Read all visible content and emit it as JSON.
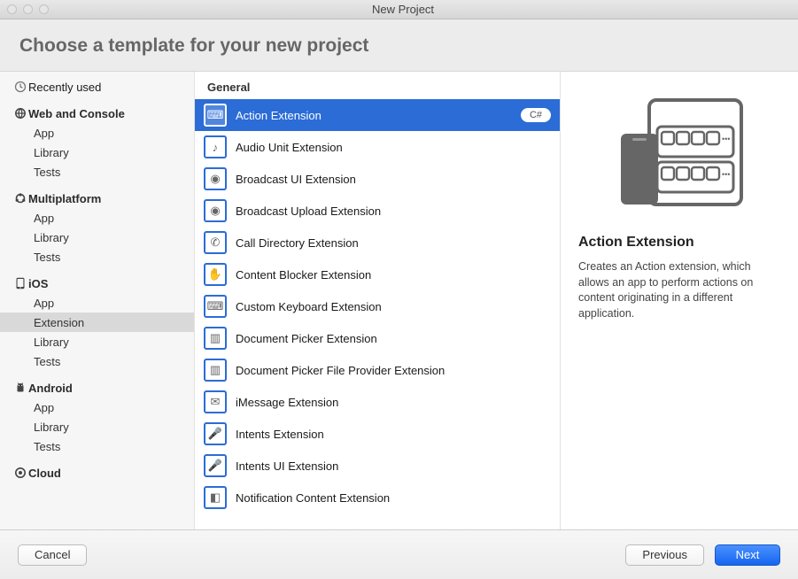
{
  "window": {
    "title": "New Project"
  },
  "header": {
    "title": "Choose a template for your new project"
  },
  "sidebar": {
    "recent_label": "Recently used",
    "groups": [
      {
        "icon": "globe",
        "label": "Web and Console",
        "items": [
          "App",
          "Library",
          "Tests"
        ]
      },
      {
        "icon": "multiplatform",
        "label": "Multiplatform",
        "items": [
          "App",
          "Library",
          "Tests"
        ]
      },
      {
        "icon": "ios",
        "label": "iOS",
        "items": [
          "App",
          "Extension",
          "Library",
          "Tests"
        ],
        "selected": "Extension"
      },
      {
        "icon": "android",
        "label": "Android",
        "items": [
          "App",
          "Library",
          "Tests"
        ]
      },
      {
        "icon": "cloud",
        "label": "Cloud",
        "items": []
      }
    ]
  },
  "section_label": "General",
  "templates": [
    {
      "name": "Action Extension",
      "icon": "⌨",
      "selected": true,
      "badge": "C#"
    },
    {
      "name": "Audio Unit Extension",
      "icon": "♪"
    },
    {
      "name": "Broadcast UI Extension",
      "icon": "◉"
    },
    {
      "name": "Broadcast Upload Extension",
      "icon": "◉"
    },
    {
      "name": "Call Directory Extension",
      "icon": "✆"
    },
    {
      "name": "Content Blocker Extension",
      "icon": "✋"
    },
    {
      "name": "Custom Keyboard Extension",
      "icon": "⌨"
    },
    {
      "name": "Document Picker Extension",
      "icon": "▥"
    },
    {
      "name": "Document Picker File Provider Extension",
      "icon": "▥"
    },
    {
      "name": "iMessage Extension",
      "icon": "✉"
    },
    {
      "name": "Intents Extension",
      "icon": "🎤"
    },
    {
      "name": "Intents UI Extension",
      "icon": "🎤"
    },
    {
      "name": "Notification Content Extension",
      "icon": "◧"
    }
  ],
  "detail": {
    "title": "Action Extension",
    "description": "Creates an Action extension, which allows an app to perform actions on content originating in a different application."
  },
  "footer": {
    "cancel": "Cancel",
    "previous": "Previous",
    "next": "Next"
  }
}
